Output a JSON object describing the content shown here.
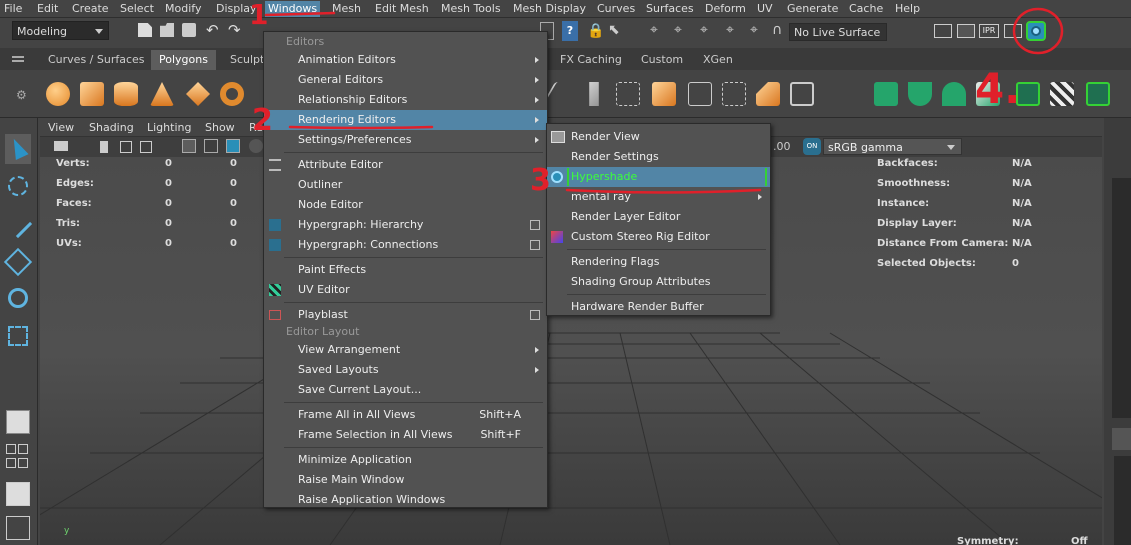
{
  "menubar": {
    "items": [
      "File",
      "Edit",
      "Create",
      "Select",
      "Modify",
      "Display",
      "Windows",
      "Mesh",
      "Edit Mesh",
      "Mesh Tools",
      "Mesh Display",
      "Curves",
      "Surfaces",
      "Deform",
      "UV",
      "Generate",
      "Cache",
      "Help"
    ]
  },
  "statusline": {
    "mode": "Modeling",
    "live_surface": "No Live Surface",
    "ipr_label": "IPR"
  },
  "shelf": {
    "tabs": [
      "Curves / Surfaces",
      "Polygons",
      "Sculpt",
      "FX Caching",
      "Custom",
      "XGen"
    ],
    "active_tab": "Polygons"
  },
  "viewport": {
    "menus": [
      "View",
      "Shading",
      "Lighting",
      "Show",
      "Re"
    ],
    "exposure_value": ".00",
    "color_space": "sRGB gamma",
    "hud_left": [
      {
        "label": "Verts:",
        "a": "0",
        "b": "0"
      },
      {
        "label": "Edges:",
        "a": "0",
        "b": "0"
      },
      {
        "label": "Faces:",
        "a": "0",
        "b": "0"
      },
      {
        "label": "Tris:",
        "a": "0",
        "b": "0"
      },
      {
        "label": "UVs:",
        "a": "0",
        "b": "0"
      }
    ],
    "hud_right": [
      {
        "label": "Backfaces:",
        "value": "N/A"
      },
      {
        "label": "Smoothness:",
        "value": "N/A"
      },
      {
        "label": "Instance:",
        "value": "N/A"
      },
      {
        "label": "Display Layer:",
        "value": "N/A"
      },
      {
        "label": "Distance From Camera:",
        "value": "N/A"
      },
      {
        "label": "Selected Objects:",
        "value": "0"
      }
    ],
    "symmetry_label": "Symmetry:",
    "symmetry_value": "Off",
    "axis_label": "y"
  },
  "windows_menu": {
    "header_editors": "Editors",
    "header_layout": "Editor Layout",
    "items_editors": [
      {
        "label": "Animation Editors",
        "submenu": true
      },
      {
        "label": "General Editors",
        "submenu": true
      },
      {
        "label": "Relationship Editors",
        "submenu": true
      },
      {
        "label": "Rendering Editors",
        "submenu": true,
        "highlight": true
      },
      {
        "label": "Settings/Preferences",
        "submenu": true
      }
    ],
    "items_mid": [
      {
        "label": "Attribute Editor"
      },
      {
        "label": "Outliner"
      },
      {
        "label": "Node Editor"
      },
      {
        "label": "Hypergraph: Hierarchy",
        "option": true
      },
      {
        "label": "Hypergraph: Connections",
        "option": true
      }
    ],
    "items_mid2": [
      {
        "label": "Paint Effects"
      },
      {
        "label": "UV Editor"
      }
    ],
    "playblast": "Playblast",
    "items_layout": [
      {
        "label": "View Arrangement",
        "submenu": true
      },
      {
        "label": "Saved Layouts",
        "submenu": true
      },
      {
        "label": "Save Current Layout..."
      }
    ],
    "frame_all": "Frame All in All Views",
    "frame_all_shortcut": "Shift+A",
    "frame_sel": "Frame Selection in All Views",
    "frame_sel_shortcut": "Shift+F",
    "items_app": [
      "Minimize Application",
      "Raise Main Window",
      "Raise Application Windows"
    ]
  },
  "rendering_submenu": {
    "items1": [
      "Render View",
      "Render Settings"
    ],
    "hypershade": "Hypershade",
    "mental_ray": "mental ray",
    "items2": [
      "Render Layer Editor",
      "Custom Stereo Rig Editor"
    ],
    "items3": [
      "Rendering Flags",
      "Shading Group Attributes"
    ],
    "items4": [
      "Hardware Render Buffer"
    ]
  },
  "annotations": {
    "step1": "1",
    "step2": "2",
    "step3": "3",
    "step4": "4."
  },
  "colors": {
    "menu_bg": "#525252",
    "highlight": "#5285a6",
    "annotation_red": "#e0202a",
    "hypershade_text": "#3cff3c"
  }
}
